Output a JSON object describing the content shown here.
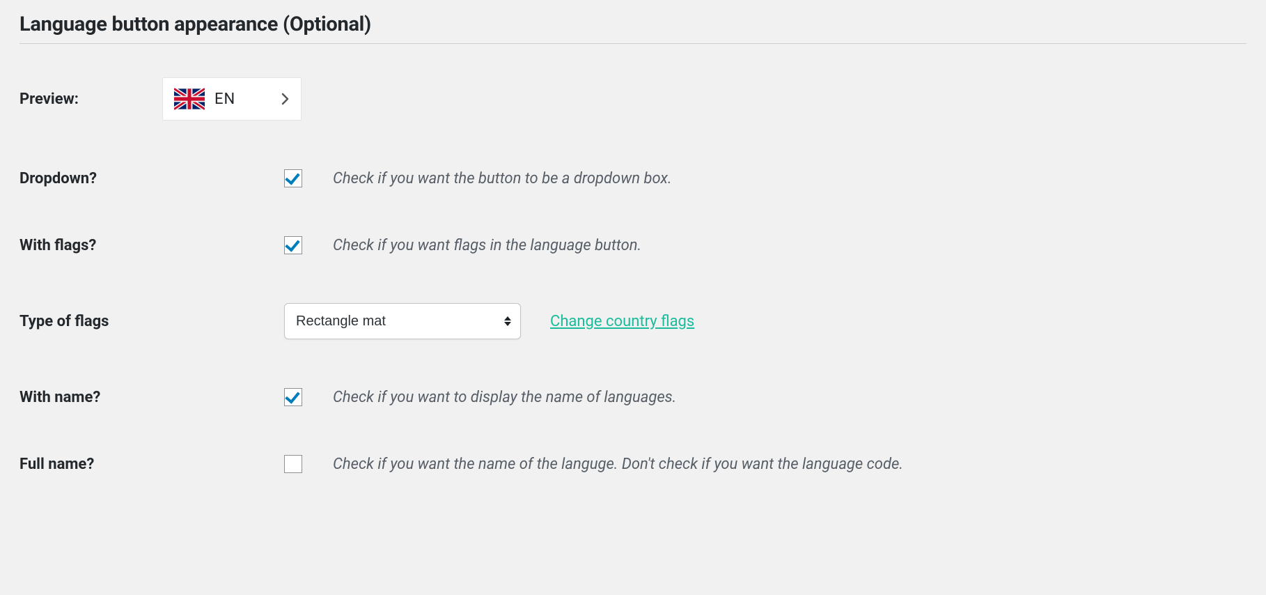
{
  "section_title": "Language button appearance (Optional)",
  "preview": {
    "label": "Preview:",
    "lang_code": "EN"
  },
  "rows": {
    "dropdown": {
      "label": "Dropdown?",
      "desc": "Check if you want the button to be a dropdown box.",
      "checked": true
    },
    "with_flags": {
      "label": "With flags?",
      "desc": "Check if you want flags in the language button.",
      "checked": true
    },
    "type_of_flags": {
      "label": "Type of flags",
      "selected": "Rectangle mat",
      "link_text": "Change country flags"
    },
    "with_name": {
      "label": "With name?",
      "desc": "Check if you want to display the name of languages.",
      "checked": true
    },
    "full_name": {
      "label": "Full name?",
      "desc": "Check if you want the name of the languge. Don't check if you want the language code.",
      "checked": false
    }
  }
}
